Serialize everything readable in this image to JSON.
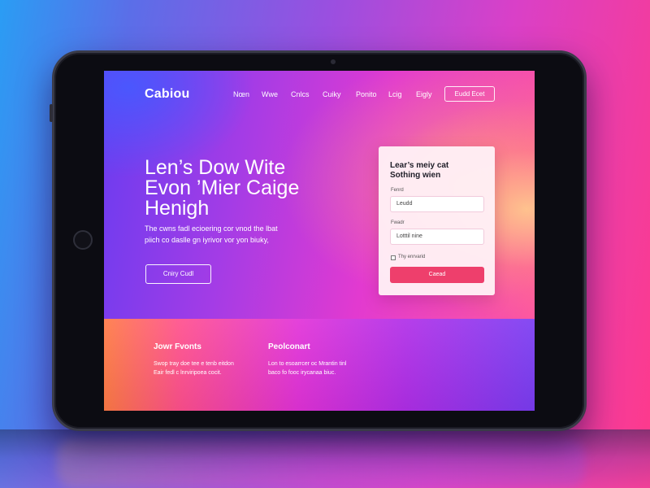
{
  "site": {
    "logo": "Cabiou"
  },
  "nav": {
    "items": [
      {
        "label": "Nœn"
      },
      {
        "label": "Wwe"
      },
      {
        "label": "Cnlcs"
      },
      {
        "label": "Cuiky"
      },
      {
        "label": "Ponito"
      },
      {
        "label": "Lcig"
      },
      {
        "label": "Eigly"
      }
    ],
    "cta_label": "Eudd Ecet"
  },
  "hero": {
    "headline_line1": "Len’s Dow Wite",
    "headline_line2": "Evon ’Mier Caige",
    "headline_line3": "Henigh",
    "sub_line1": "The cwns fadl ecioering cor vnod the lbat",
    "sub_line2": "piich co daslle gn iyrivor vor yon biuky,",
    "button_label": "Cniry Cudl"
  },
  "form": {
    "title_line1": "Lear’s meiy cat",
    "title_line2": "Sothing wien",
    "field1": {
      "label": "Fenrd",
      "value": "Leudd"
    },
    "field2": {
      "label": "Fwadr",
      "value": "Lotttil nine"
    },
    "checkbox_label": "Thy enrvarid",
    "submit_label": "Caead"
  },
  "footer": {
    "col1": {
      "title": "Jowr Fvonts",
      "line1": "Swop tray doe tee e tenb eitdon",
      "line2": "Eair fedl c lnrviripoea cocit."
    },
    "col2": {
      "title": "Peolconart",
      "line1": "Lon to esoarrcer oc Mrantin tinl",
      "line2": "baco fo fooc irycanaa biuc."
    }
  },
  "colors": {
    "accent": "#ee3f6c",
    "card_bg": "#fff0f6",
    "bezel": "#0c0c12"
  }
}
